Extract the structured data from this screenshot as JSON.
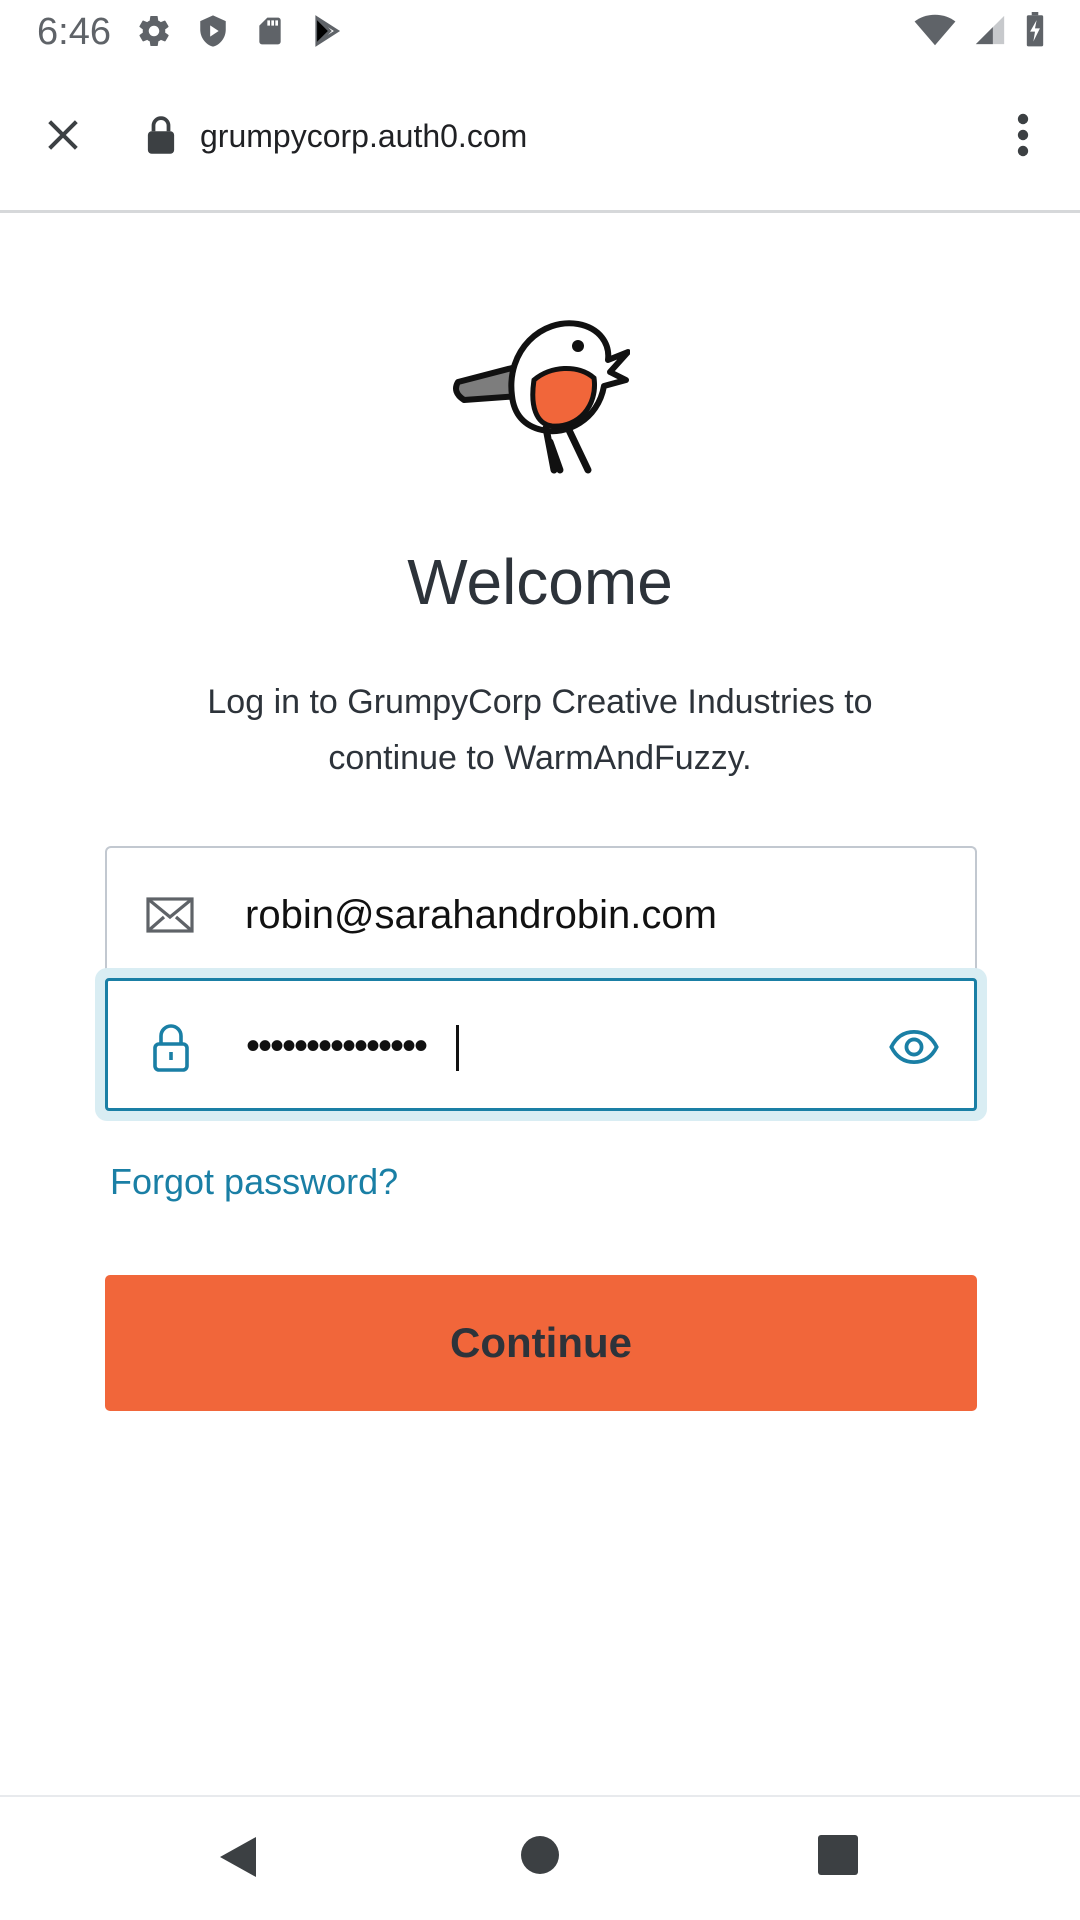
{
  "status_bar": {
    "time": "6:46",
    "left_icons": [
      "settings-icon",
      "shield-play-icon",
      "sd-card-icon",
      "play-store-icon"
    ],
    "right_icons": [
      "wifi-icon",
      "cell-signal-icon",
      "battery-charging-icon"
    ]
  },
  "browser": {
    "url": "grumpycorp.auth0.com",
    "icons": [
      "close-icon",
      "lock-icon",
      "more-vertical-icon"
    ]
  },
  "login": {
    "logo": "robin-bird-logo",
    "title": "Welcome",
    "subtitle": "Log in to GrumpyCorp Creative Industries to continue to WarmAndFuzzy.",
    "email_value": "robin@sarahandrobin.com",
    "password_masked": "•••••••••••••••",
    "forgot_password": "Forgot password?",
    "continue_label": "Continue",
    "colors": {
      "accent": "#f1663a",
      "link": "#1a7fa5",
      "text": "#2d333a"
    }
  },
  "nav": {
    "icons": [
      "back-icon",
      "home-icon",
      "recents-icon"
    ]
  }
}
